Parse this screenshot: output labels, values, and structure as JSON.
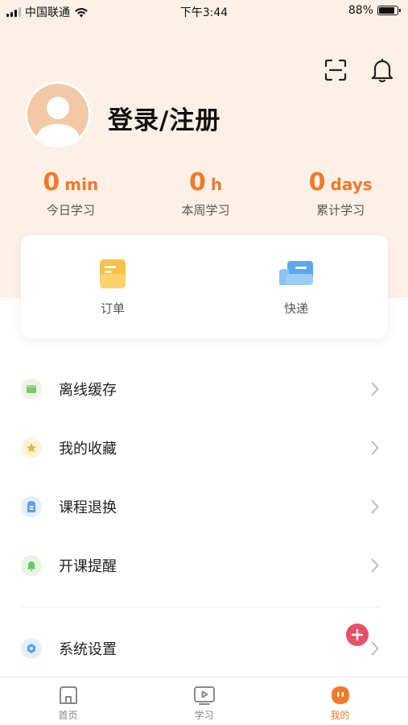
{
  "status_bar": {
    "carrier": "中国联通",
    "time": "下午3:44",
    "battery": "88%",
    "battery_level": 0.88
  },
  "profile": {
    "login_label": "登录/注册"
  },
  "stats": [
    {
      "value": "0",
      "unit": "min",
      "label": "今日学习"
    },
    {
      "value": "0",
      "unit": "h",
      "label": "本周学习"
    },
    {
      "value": "0",
      "unit": "days",
      "label": "累计学习"
    }
  ],
  "card": {
    "items": [
      {
        "label": "订单",
        "icon": "order-icon"
      },
      {
        "label": "快递",
        "icon": "delivery-icon"
      }
    ]
  },
  "menu": {
    "items": [
      {
        "label": "离线缓存",
        "icon": "offline-cache-icon",
        "color": "#7fc36b"
      },
      {
        "label": "我的收藏",
        "icon": "star-icon",
        "color": "#f2b22e"
      },
      {
        "label": "课程退换",
        "icon": "course-return-icon",
        "color": "#5f9ee8"
      },
      {
        "label": "开课提醒",
        "icon": "bell-reminder-icon",
        "color": "#6bc36b"
      }
    ],
    "settings": {
      "label": "系统设置",
      "icon": "settings-icon",
      "color": "#5f9ee8"
    }
  },
  "tabbar": {
    "items": [
      {
        "label": "首页",
        "icon": "home-icon",
        "active": false
      },
      {
        "label": "学习",
        "icon": "play-icon",
        "active": false
      },
      {
        "label": "我的",
        "icon": "mine-icon",
        "active": true
      }
    ]
  },
  "colors": {
    "accent": "#f07a2a",
    "header_bg": "#fdf1e7",
    "badge": "#e8506a"
  }
}
